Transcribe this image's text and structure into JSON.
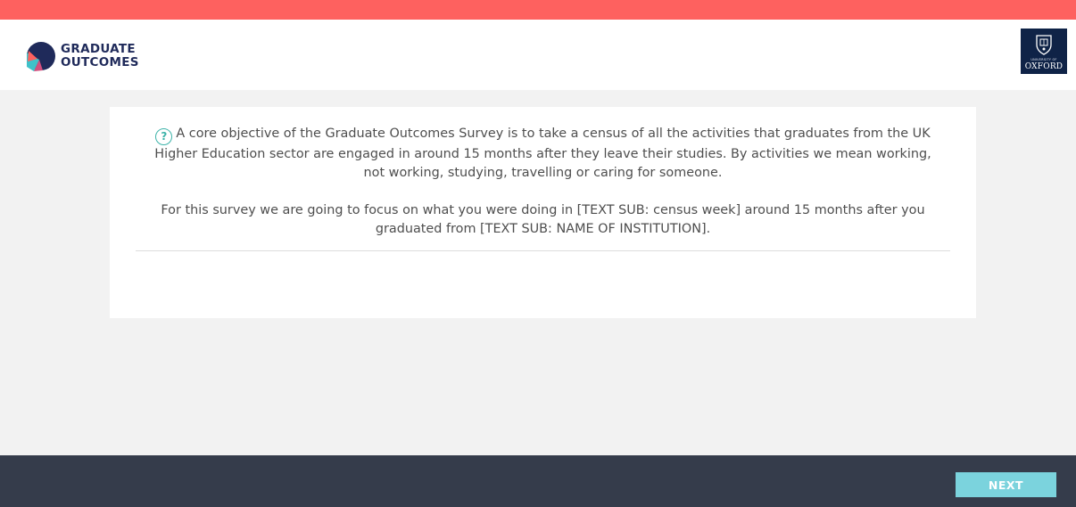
{
  "header": {
    "logo_line1": "GRADUATE",
    "logo_line2": "OUTCOMES",
    "university_small": "UNIVERSITY OF",
    "university_name": "OXFORD"
  },
  "question": {
    "help_icon": "?",
    "paragraph1": "A core objective of the Graduate Outcomes Survey is to take a census of all the activities that graduates from the UK Higher Education sector are engaged in around 15 months after they leave their studies. By activities we mean working, not working, studying, travelling or caring for someone.",
    "paragraph2": "For this survey we are going to focus on what you were doing in [TEXT SUB: census week] around 15 months after you graduated from [TEXT SUB: NAME OF INSTITUTION]."
  },
  "footer": {
    "next_label": "NEXT"
  },
  "colors": {
    "top_bar": "#fe615f",
    "navy": "#1f2a5a",
    "footer": "#353c4b",
    "next_button": "#7bd3dd",
    "help_icon": "#3db3a9",
    "oxford_blue": "#0f2347"
  }
}
